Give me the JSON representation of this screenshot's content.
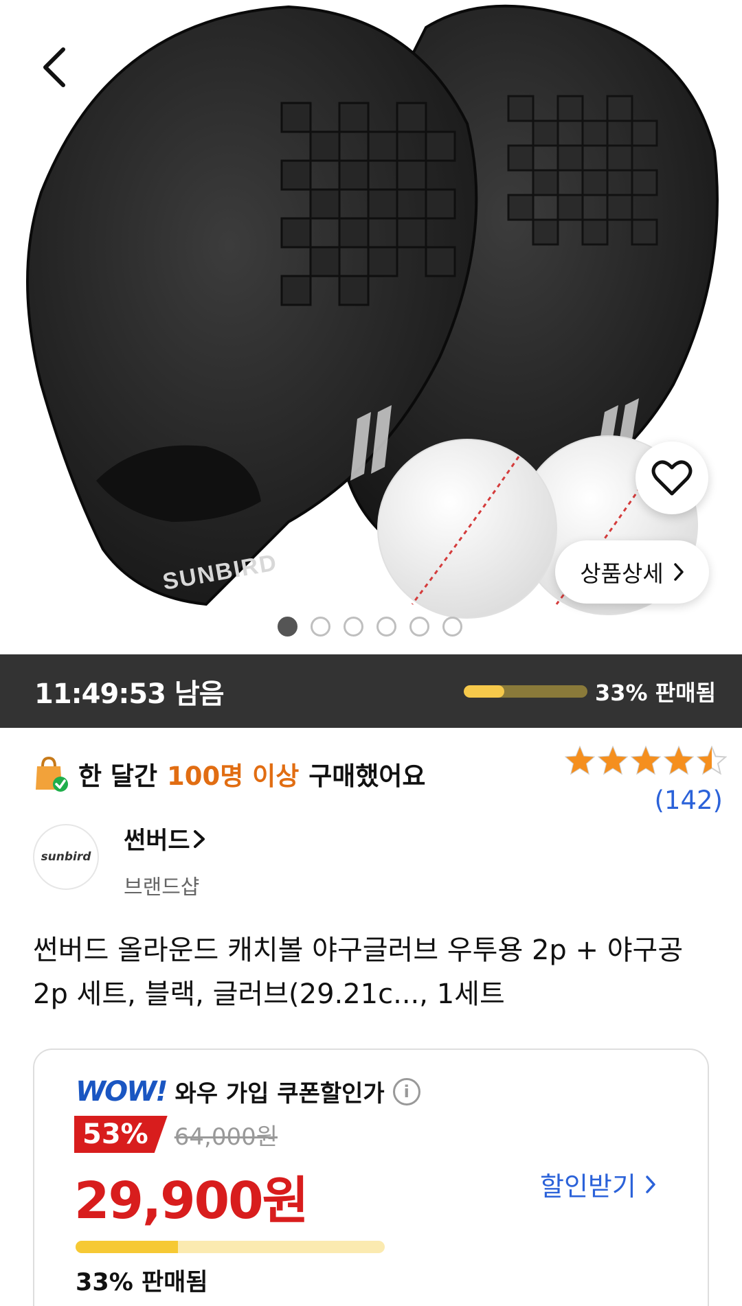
{
  "colors": {
    "accent_red": "#d81d1d",
    "accent_blue": "#2b62d9",
    "star": "#f58f1e",
    "highlight_orange": "#e16d12",
    "timer_bg": "#333333"
  },
  "hero": {
    "product_image": "baseball-gloves-and-balls-image",
    "brand_mark": "SUNBIRD",
    "detail_button_label": "상품상세",
    "carousel_count": 6,
    "carousel_active": 0
  },
  "timer": {
    "remaining": "11:49:53 남음",
    "sold_fraction": 0.33,
    "sold_label": "33% 판매됨"
  },
  "purchase_notice": {
    "prefix": "한 달간",
    "highlight": "100명 이상",
    "suffix": "구매했어요"
  },
  "rating": {
    "stars": 4.5,
    "review_count": "(142)"
  },
  "brand": {
    "logo_text": "sunbird",
    "name": "썬버드",
    "shop_label": "브랜드샵"
  },
  "product_title": "썬버드 올라운드 캐치볼 야구글러브 우투용 2p + 야구공 2p 세트, 블랙, 글러브(29.21c..., 1세트",
  "coupon": {
    "wow_logo": "WOW!",
    "label": "와우 가입 쿠폰할인가",
    "discount_badge": "53%",
    "original_price": "64,000원",
    "final_price": "29,900원",
    "get_discount_label": "할인받기",
    "sold_fraction": 0.33,
    "sold_label": "33% 판매됨"
  }
}
